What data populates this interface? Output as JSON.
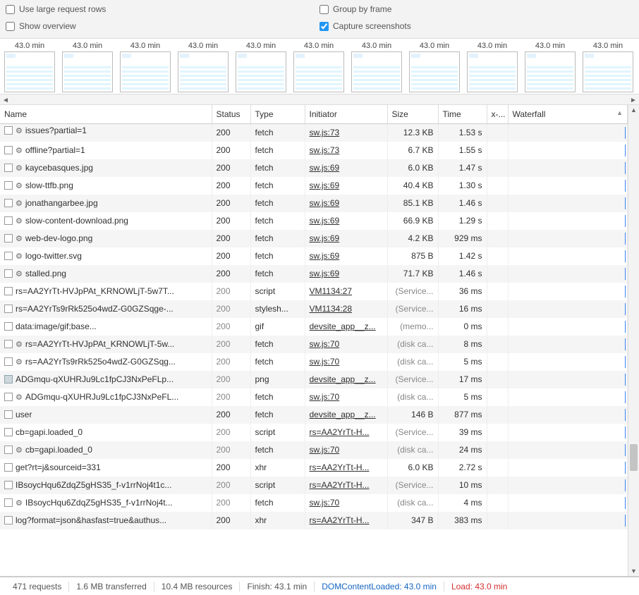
{
  "options": {
    "large_rows": "Use large request rows",
    "show_overview": "Show overview",
    "group_by_frame": "Group by frame",
    "capture_screenshots": "Capture screenshots"
  },
  "thumb_label": "43.0 min",
  "columns": {
    "name": "Name",
    "status": "Status",
    "type": "Type",
    "initiator": "Initiator",
    "size": "Size",
    "time": "Time",
    "x": "x-...",
    "waterfall": "Waterfall"
  },
  "rows": [
    {
      "icon": "gear",
      "name": "issues?partial=1",
      "status": "200",
      "status_muted": false,
      "type": "fetch",
      "initiator": "sw.js:73",
      "size": "12.3 KB",
      "size_muted": false,
      "time": "1.53 s",
      "partial": true
    },
    {
      "icon": "gear",
      "name": "offline?partial=1",
      "status": "200",
      "status_muted": false,
      "type": "fetch",
      "initiator": "sw.js:73",
      "size": "6.7 KB",
      "size_muted": false,
      "time": "1.55 s"
    },
    {
      "icon": "gear",
      "name": "kaycebasques.jpg",
      "status": "200",
      "status_muted": false,
      "type": "fetch",
      "initiator": "sw.js:69",
      "size": "6.0 KB",
      "size_muted": false,
      "time": "1.47 s"
    },
    {
      "icon": "gear",
      "name": "slow-ttfb.png",
      "status": "200",
      "status_muted": false,
      "type": "fetch",
      "initiator": "sw.js:69",
      "size": "40.4 KB",
      "size_muted": false,
      "time": "1.30 s"
    },
    {
      "icon": "gear",
      "name": "jonathangarbee.jpg",
      "status": "200",
      "status_muted": false,
      "type": "fetch",
      "initiator": "sw.js:69",
      "size": "85.1 KB",
      "size_muted": false,
      "time": "1.46 s"
    },
    {
      "icon": "gear",
      "name": "slow-content-download.png",
      "status": "200",
      "status_muted": false,
      "type": "fetch",
      "initiator": "sw.js:69",
      "size": "66.9 KB",
      "size_muted": false,
      "time": "1.29 s"
    },
    {
      "icon": "gear",
      "name": "web-dev-logo.png",
      "status": "200",
      "status_muted": false,
      "type": "fetch",
      "initiator": "sw.js:69",
      "size": "4.2 KB",
      "size_muted": false,
      "time": "929 ms"
    },
    {
      "icon": "gear",
      "name": "logo-twitter.svg",
      "status": "200",
      "status_muted": false,
      "type": "fetch",
      "initiator": "sw.js:69",
      "size": "875 B",
      "size_muted": false,
      "time": "1.42 s"
    },
    {
      "icon": "gear",
      "name": "stalled.png",
      "status": "200",
      "status_muted": false,
      "type": "fetch",
      "initiator": "sw.js:69",
      "size": "71.7 KB",
      "size_muted": false,
      "time": "1.46 s"
    },
    {
      "icon": "none",
      "name": "rs=AA2YrTt-HVJpPAt_KRNOWLjT-5w7T...",
      "status": "200",
      "status_muted": true,
      "type": "script",
      "initiator": "VM1134:27",
      "size": "(Service...",
      "size_muted": true,
      "time": "36 ms"
    },
    {
      "icon": "none",
      "name": "rs=AA2YrTs9rRk525o4wdZ-G0GZSqge-...",
      "status": "200",
      "status_muted": true,
      "type": "stylesh...",
      "initiator": "VM1134:28",
      "size": "(Service...",
      "size_muted": true,
      "time": "16 ms"
    },
    {
      "icon": "none",
      "name": "data:image/gif;base...",
      "status": "200",
      "status_muted": true,
      "type": "gif",
      "initiator": "devsite_app__z...",
      "size": "(memo...",
      "size_muted": true,
      "time": "0 ms"
    },
    {
      "icon": "gear",
      "name": "rs=AA2YrTt-HVJpPAt_KRNOWLjT-5w...",
      "status": "200",
      "status_muted": true,
      "type": "fetch",
      "initiator": "sw.js:70",
      "size": "(disk ca...",
      "size_muted": true,
      "time": "8 ms"
    },
    {
      "icon": "gear",
      "name": "rs=AA2YrTs9rRk525o4wdZ-G0GZSqg...",
      "status": "200",
      "status_muted": true,
      "type": "fetch",
      "initiator": "sw.js:70",
      "size": "(disk ca...",
      "size_muted": true,
      "time": "5 ms"
    },
    {
      "icon": "pic",
      "name": "ADGmqu-qXUHRJu9Lc1fpCJ3NxPeFLp...",
      "status": "200",
      "status_muted": true,
      "type": "png",
      "initiator": "devsite_app__z...",
      "size": "(Service...",
      "size_muted": true,
      "time": "17 ms"
    },
    {
      "icon": "gear",
      "name": "ADGmqu-qXUHRJu9Lc1fpCJ3NxPeFL...",
      "status": "200",
      "status_muted": true,
      "type": "fetch",
      "initiator": "sw.js:70",
      "size": "(disk ca...",
      "size_muted": true,
      "time": "5 ms"
    },
    {
      "icon": "none",
      "name": "user",
      "status": "200",
      "status_muted": false,
      "type": "fetch",
      "initiator": "devsite_app__z...",
      "size": "146 B",
      "size_muted": false,
      "time": "877 ms"
    },
    {
      "icon": "none",
      "name": "cb=gapi.loaded_0",
      "status": "200",
      "status_muted": true,
      "type": "script",
      "initiator": "rs=AA2YrTt-H...",
      "size": "(Service...",
      "size_muted": true,
      "time": "39 ms"
    },
    {
      "icon": "gear",
      "name": "cb=gapi.loaded_0",
      "status": "200",
      "status_muted": true,
      "type": "fetch",
      "initiator": "sw.js:70",
      "size": "(disk ca...",
      "size_muted": true,
      "time": "24 ms"
    },
    {
      "icon": "none",
      "name": "get?rt=j&sourceid=331",
      "status": "200",
      "status_muted": false,
      "type": "xhr",
      "initiator": "rs=AA2YrTt-H...",
      "size": "6.0 KB",
      "size_muted": false,
      "time": "2.72 s"
    },
    {
      "icon": "none",
      "name": "IBsoycHqu6ZdqZ5gHS35_f-v1rrNoj4t1c...",
      "status": "200",
      "status_muted": true,
      "type": "script",
      "initiator": "rs=AA2YrTt-H...",
      "size": "(Service...",
      "size_muted": true,
      "time": "10 ms"
    },
    {
      "icon": "gear",
      "name": "IBsoycHqu6ZdqZ5gHS35_f-v1rrNoj4t...",
      "status": "200",
      "status_muted": true,
      "type": "fetch",
      "initiator": "sw.js:70",
      "size": "(disk ca...",
      "size_muted": true,
      "time": "4 ms"
    },
    {
      "icon": "none",
      "name": "log?format=json&hasfast=true&authus...",
      "status": "200",
      "status_muted": false,
      "type": "xhr",
      "initiator": "rs=AA2YrTt-H...",
      "size": "347 B",
      "size_muted": false,
      "time": "383 ms"
    }
  ],
  "status": {
    "requests": "471 requests",
    "transferred": "1.6 MB transferred",
    "resources": "10.4 MB resources",
    "finish": "Finish: 43.1 min",
    "dcm": "DOMContentLoaded: 43.0 min",
    "load": "Load: 43.0 min"
  }
}
